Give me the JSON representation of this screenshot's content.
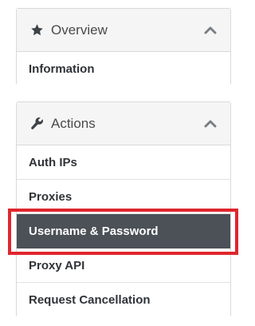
{
  "overview": {
    "title": "Overview",
    "icon": "star-icon",
    "collapse_icon": "chevron-up-icon",
    "items": [
      {
        "label": "Information"
      }
    ]
  },
  "actions": {
    "title": "Actions",
    "icon": "wrench-icon",
    "collapse_icon": "chevron-up-icon",
    "items": [
      {
        "label": "Auth IPs",
        "active": false
      },
      {
        "label": "Proxies",
        "active": false
      },
      {
        "label": "Username & Password",
        "active": true
      },
      {
        "label": "Proxy API",
        "active": false
      },
      {
        "label": "Request Cancellation",
        "active": false
      }
    ]
  },
  "colors": {
    "active_bg": "#4b5157",
    "highlight_border": "#e0262d",
    "header_bg": "#f5f5f5",
    "border": "#d9d9d9"
  }
}
